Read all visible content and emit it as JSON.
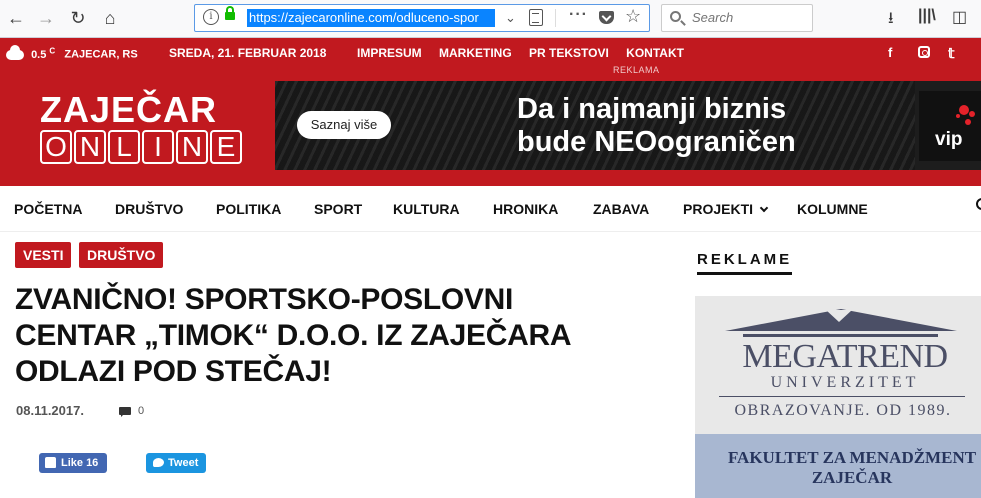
{
  "browser": {
    "url": "https://zajecaronline.com/odluceno-spor",
    "search_placeholder": "Search",
    "back_icon": "back-arrow-icon",
    "forward_icon": "forward-arrow-icon",
    "reload_icon": "reload-icon",
    "home_icon": "home-icon"
  },
  "topbar": {
    "temperature": "0.5",
    "temp_unit": "C",
    "location": "ZAJECAR, RS",
    "date": "SREDA, 21. FEBRUAR 2018",
    "links": [
      "IMPRESUM",
      "MARKETING",
      "PR TEKSTOVI",
      "KONTAKT"
    ],
    "reklama_label": "REKLAMA",
    "social": [
      "facebook",
      "instagram",
      "twitter"
    ]
  },
  "logo": {
    "line1": "ZAJEČAR",
    "line2": [
      "O",
      "N",
      "L",
      "I",
      "N",
      "E"
    ]
  },
  "banner": {
    "button": "Saznaj više",
    "headline_line1": "Da i najmanji biznis",
    "headline_line2": "bude NEOograničen",
    "brand": "vip"
  },
  "nav": {
    "items": [
      "POČETNA",
      "DRUŠTVO",
      "POLITIKA",
      "SPORT",
      "KULTURA",
      "HRONIKA",
      "ZABAVA",
      "PROJEKTI",
      "KOLUMNE"
    ]
  },
  "article": {
    "tags": [
      "VESTI",
      "DRUŠTVO"
    ],
    "title_line1": "ZVANIČNO! SPORTSKO-POSLOVNI",
    "title_line2": "CENTAR „TIMOK“ D.O.O. IZ ZAJEČARA",
    "title_line3": "ODLAZI POD STEČAJ!",
    "date": "08.11.2017.",
    "comments": "0",
    "like_label": "Like 16",
    "tweet_label": "Tweet"
  },
  "sidebar": {
    "title": "REKLAME",
    "ad1": {
      "name": "MEGATREND",
      "sub": "UNIVERZITET",
      "tagline": "OBRAZOVANJE. OD 1989."
    },
    "ad2": {
      "line1": "FAKULTET ZA MENADŽMENT",
      "line2": "ZAJEČAR"
    }
  },
  "colors": {
    "brand_red": "#c1191f",
    "url_highlight": "#0a84ff",
    "facebook": "#4267b2",
    "twitter": "#1b95e0",
    "megatrend": "#4b4f66"
  }
}
